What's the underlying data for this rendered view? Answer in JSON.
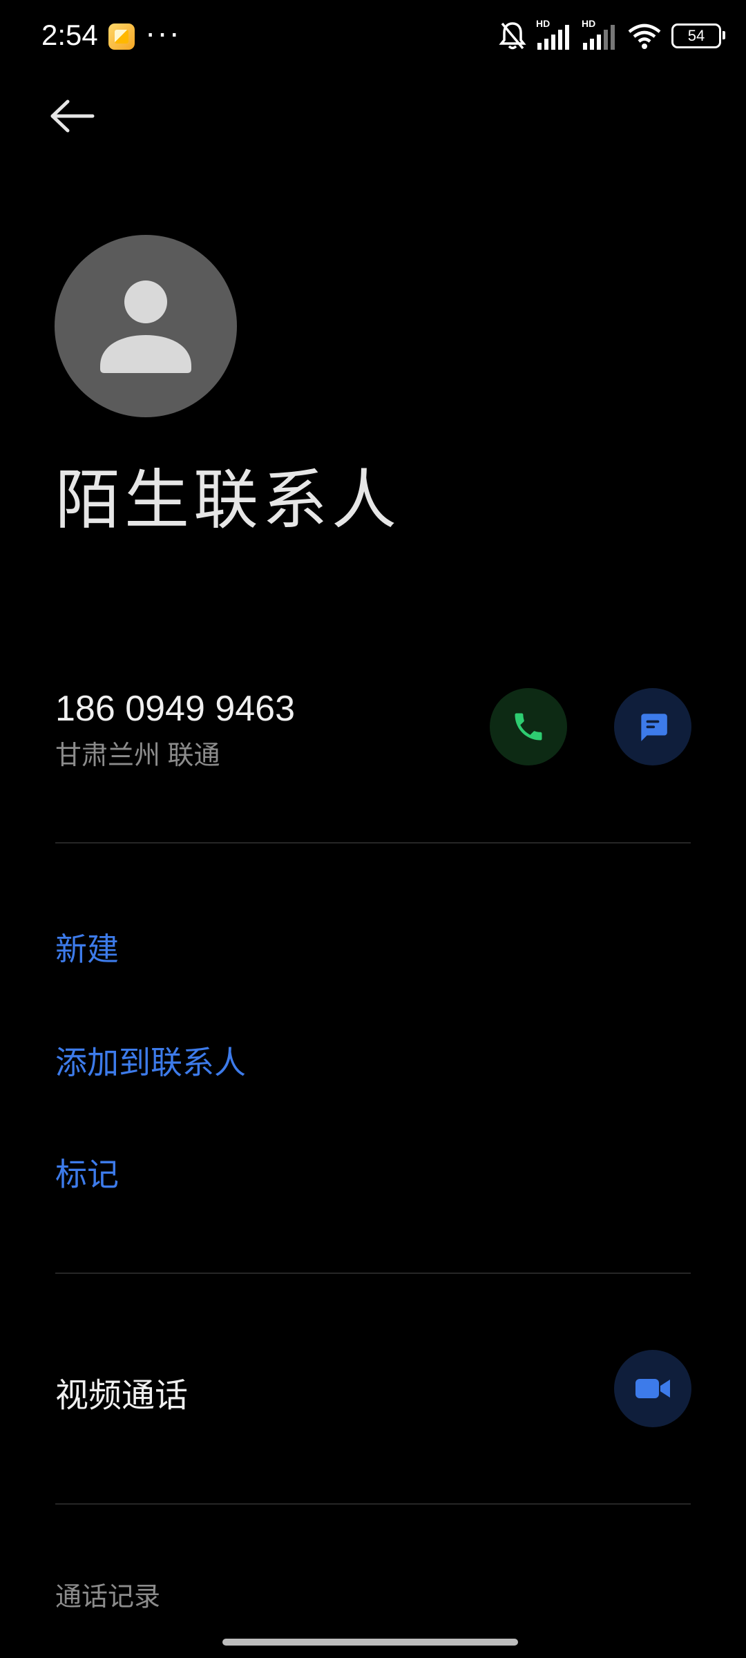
{
  "status_bar": {
    "time": "2:54",
    "more": "···",
    "signal1_label": "HD",
    "signal2_label": "HD",
    "battery": "54"
  },
  "contact": {
    "name": "陌生联系人",
    "phone": "186 0949 9463",
    "location": "甘肃兰州 联通"
  },
  "actions": {
    "new": "新建",
    "add_to_contacts": "添加到联系人",
    "mark": "标记"
  },
  "video_call": {
    "label": "视频通话"
  },
  "call_history": {
    "label": "通话记录"
  },
  "colors": {
    "accent": "#3d7bea",
    "call_green": "#2ecc71",
    "call_bg": "#0d2a14",
    "msg_bg": "#0f1e3b",
    "avatar_bg": "#5b5b5b"
  }
}
